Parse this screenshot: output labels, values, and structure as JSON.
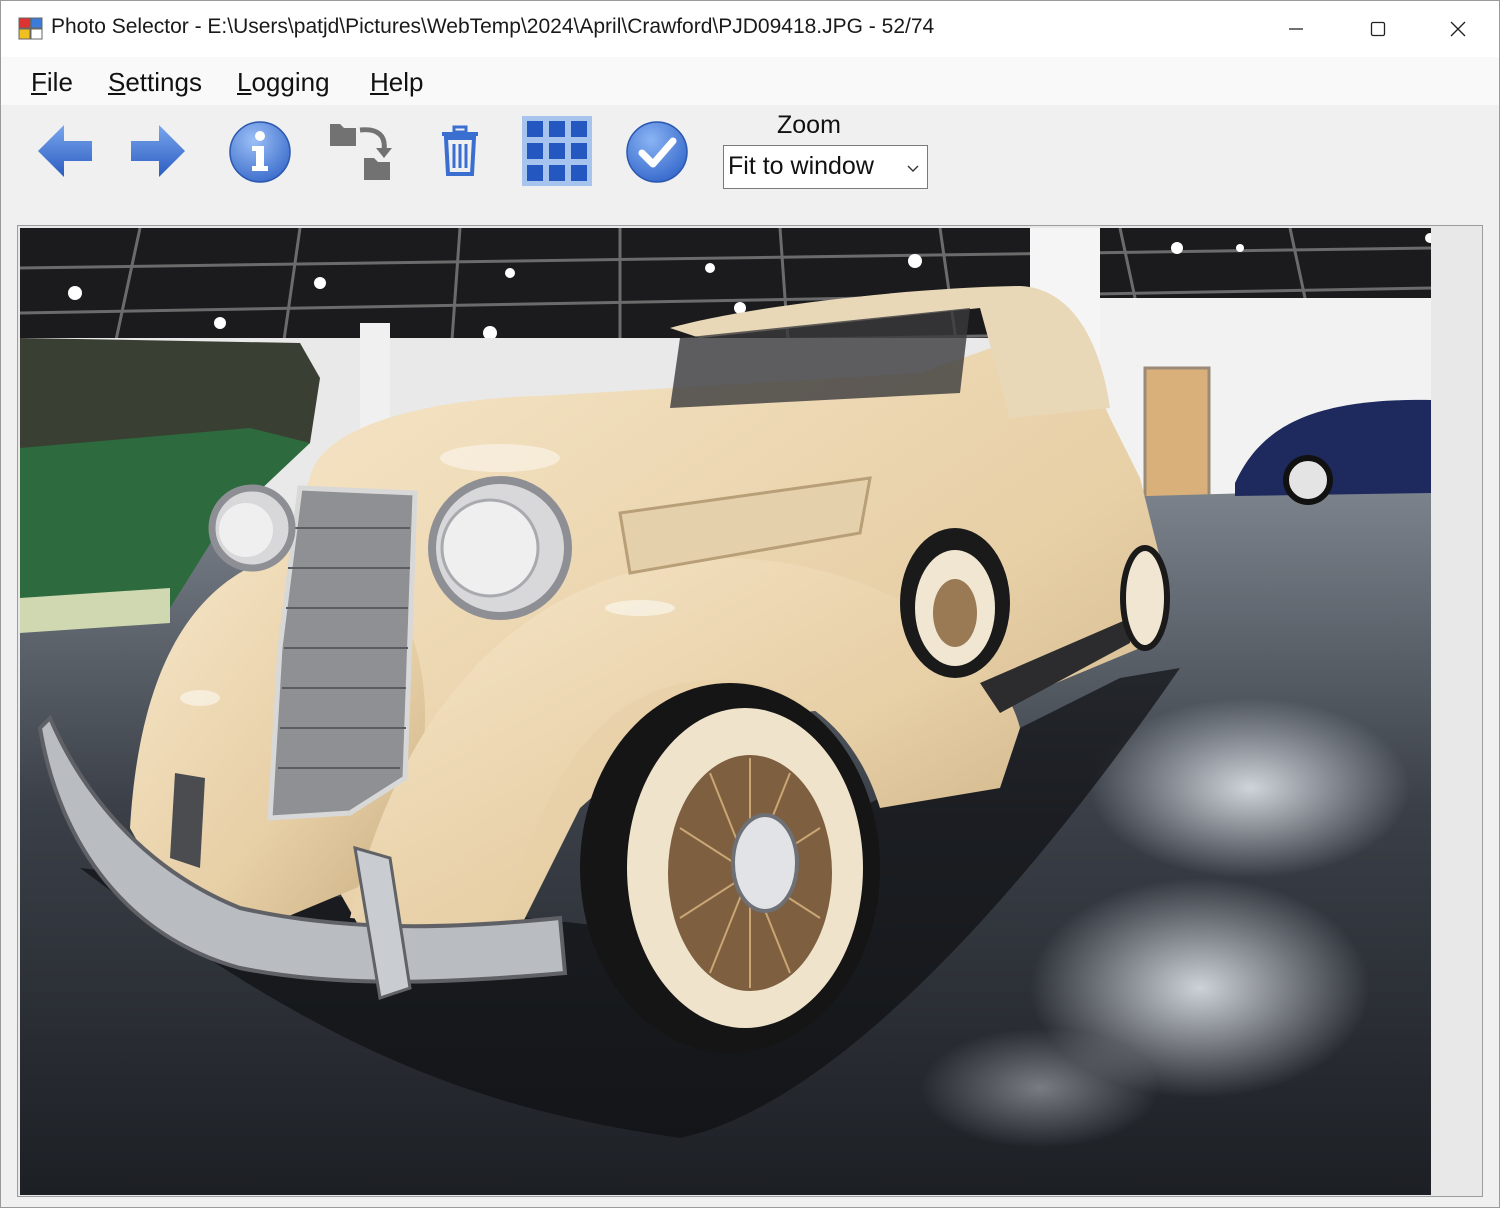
{
  "window": {
    "title": "Photo Selector - E:\\Users\\patjd\\Pictures\\WebTemp\\2024\\April\\Crawford\\PJD09418.JPG - 52/74"
  },
  "menu": {
    "items": [
      {
        "underline": "F",
        "rest": "ile"
      },
      {
        "underline": "S",
        "rest": "ettings"
      },
      {
        "underline": "L",
        "rest": "ogging"
      },
      {
        "underline": "H",
        "rest": "elp"
      }
    ]
  },
  "toolbar": {
    "zoom_label": "Zoom",
    "zoom_value": "Fit to window",
    "icons": [
      "arrow-left-icon",
      "arrow-right-icon",
      "info-icon",
      "move-folder-icon",
      "trash-icon",
      "grid-icon",
      "checkmark-icon"
    ]
  },
  "photo": {
    "subject": "cream vintage convertible car in museum showroom"
  },
  "colors": {
    "accent_blue": "#3a6fd0",
    "icon_gray": "#6f6f6f",
    "car_cream": "#ecd8b6"
  }
}
